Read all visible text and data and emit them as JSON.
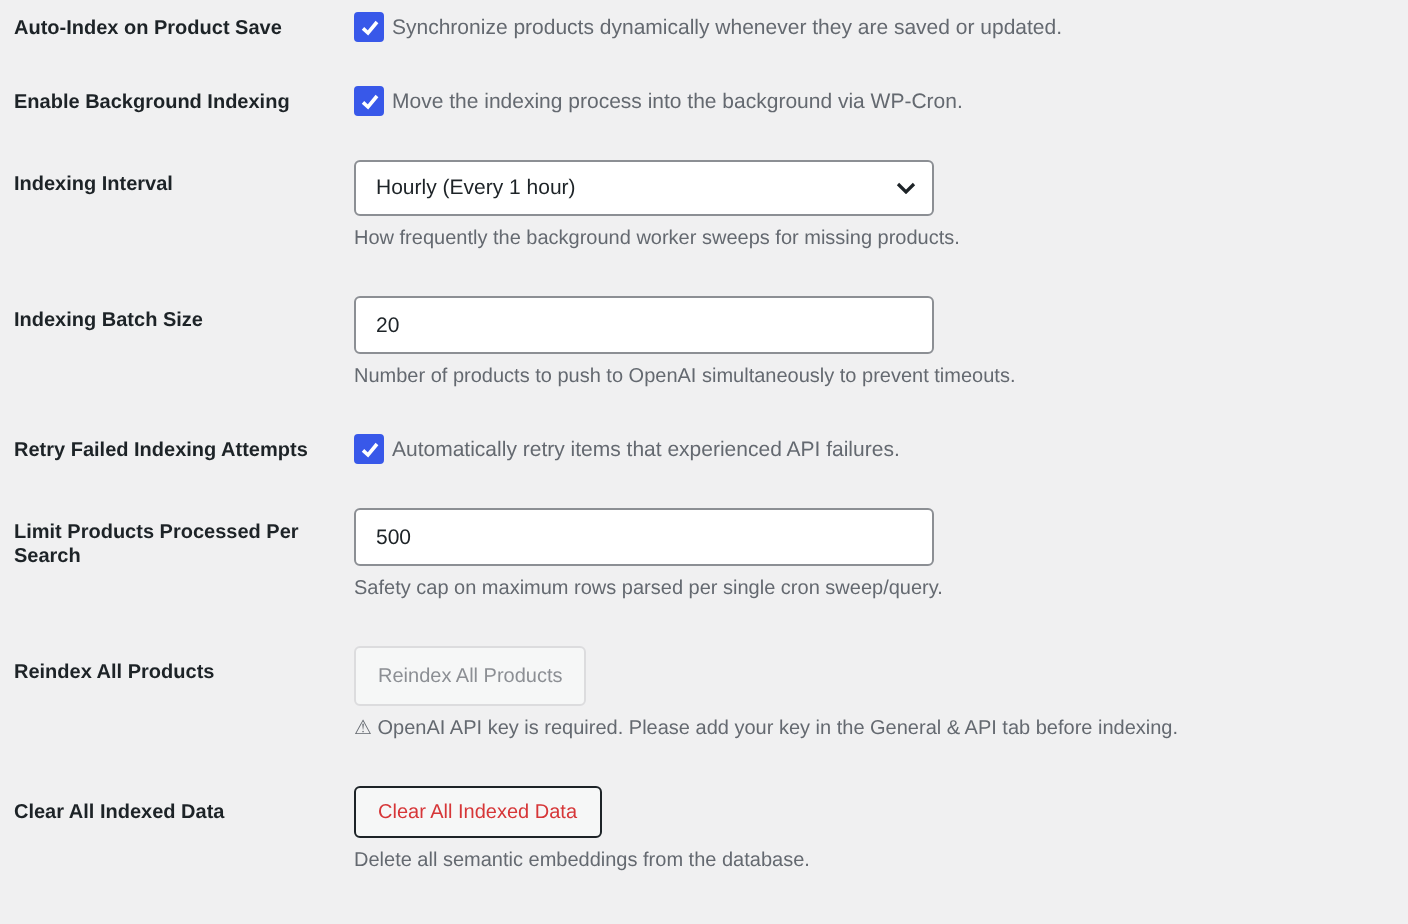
{
  "settings": [
    {
      "label": "Auto-Index on Product Save",
      "kind": "checkbox",
      "checked": true,
      "text": "Synchronize products dynamically whenever they are saved or updated."
    },
    {
      "label": "Enable Background Indexing",
      "kind": "checkbox",
      "checked": true,
      "text": "Move the indexing process into the background via WP-Cron."
    },
    {
      "label": "Indexing Interval",
      "kind": "select",
      "value": "Hourly (Every 1 hour)",
      "description": "How frequently the background worker sweeps for missing products."
    },
    {
      "label": "Indexing Batch Size",
      "kind": "text",
      "value": "20",
      "description": "Number of products to push to OpenAI simultaneously to prevent timeouts."
    },
    {
      "label": "Retry Failed Indexing Attempts",
      "kind": "checkbox",
      "checked": true,
      "text": "Automatically retry items that experienced API failures."
    },
    {
      "label": "Limit Products Processed Per Search",
      "kind": "text",
      "value": "500",
      "description": "Safety cap on maximum rows parsed per single cron sweep/query."
    },
    {
      "label": "Reindex All Products",
      "kind": "button",
      "button": "Reindex All Products",
      "disabled": true,
      "danger": false,
      "description": "⚠ OpenAI API key is required. Please add your key in the General & API tab before indexing."
    },
    {
      "label": "Clear All Indexed Data",
      "kind": "button",
      "button": "Clear All Indexed Data",
      "disabled": false,
      "danger": true,
      "description": "Delete all semantic embeddings from the database."
    }
  ]
}
